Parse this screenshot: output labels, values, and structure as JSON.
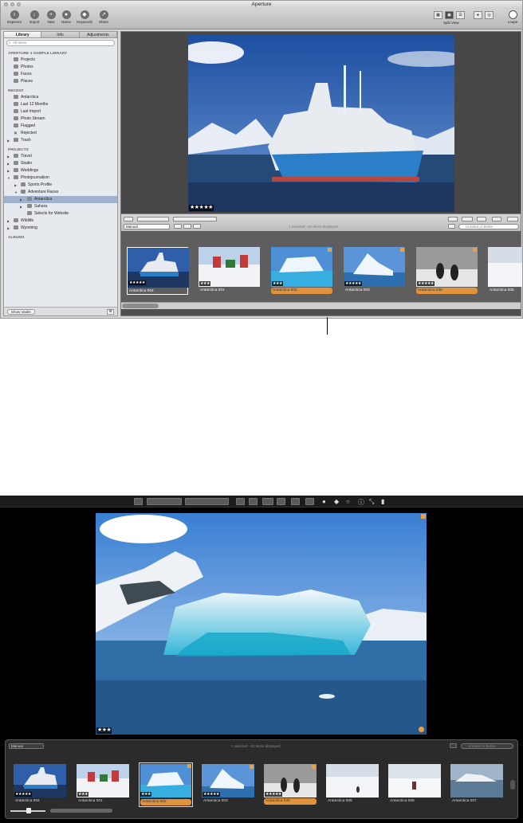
{
  "window": {
    "title": "Aperture"
  },
  "toolbar": {
    "buttons": [
      {
        "label": "Inspector",
        "icon": "info-icon"
      },
      {
        "label": "Import",
        "icon": "import-arrow-icon"
      },
      {
        "label": "New",
        "icon": "plus-icon"
      },
      {
        "label": "Name",
        "icon": "name-person-icon"
      },
      {
        "label": "Keywords",
        "icon": "keyword-tag-icon"
      },
      {
        "label": "Share",
        "icon": "share-icon"
      }
    ],
    "split_view_label": "Split View",
    "loupe_label": "Loupe"
  },
  "sidebar": {
    "tabs": [
      "Library",
      "Info",
      "Adjustments"
    ],
    "search_placeholder": "All Items",
    "library_header": "APERTURE 3 SAMPLE LIBRARY",
    "library_items": [
      "Projects",
      "Photos",
      "Faces",
      "Places"
    ],
    "recent_header": "RECENT",
    "recent_items": [
      "Antarctica",
      "Last 12 Months",
      "Last Import",
      "Photo Stream",
      "Flagged",
      "Rejected",
      "Trash"
    ],
    "projects_header": "PROJECTS",
    "projects_items": [
      "Travel",
      "Studio",
      "Weddings",
      "Photojournalism",
      "Sports Profile",
      "Adventure Races",
      "Antarctica",
      "Sahara",
      "Selects for Website",
      "Wildlife",
      "Wyoming"
    ],
    "albums_header": "ALBUMS",
    "show_vaults": "Show Vaults"
  },
  "viewer": {
    "rating_stars": "★★★★★"
  },
  "control_bar": {
    "sort": "Manual",
    "status": "1 selected - 62 items displayed",
    "filter_placeholder": "Unrated or Better"
  },
  "thumbnails": [
    {
      "name": "Antarctica 004",
      "stars": "★★★★★"
    },
    {
      "name": "Antarctica 001",
      "stars": "★★★"
    },
    {
      "name": "Antarctica 002",
      "stars": "★★★"
    },
    {
      "name": "Antarctica 003",
      "stars": "★★★★★"
    },
    {
      "name": "Antarctica 039",
      "stars": "★★★★★"
    },
    {
      "name": "Antarctica 005",
      "stars": ""
    }
  ],
  "fullscreen": {
    "viewer_stars": "★★★",
    "sort": "Manual",
    "status": "1 selected - 62 items displayed",
    "filter_placeholder": "Unrated or Better",
    "thumbnails": [
      {
        "name": "Antarctica 004",
        "stars": "★★★★★"
      },
      {
        "name": "Antarctica 001",
        "stars": "★★★"
      },
      {
        "name": "Antarctica 002",
        "stars": "★★★"
      },
      {
        "name": "Antarctica 003",
        "stars": "★★★★★"
      },
      {
        "name": "Antarctica 039",
        "stars": "★★★★★"
      },
      {
        "name": "Antarctica 005",
        "stars": ""
      },
      {
        "name": "Antarctica 006",
        "stars": ""
      },
      {
        "name": "Antarctica 007",
        "stars": ""
      }
    ]
  },
  "colors": {
    "selection": "#e0923c",
    "sidebar_selection": "#9eb1cf"
  }
}
